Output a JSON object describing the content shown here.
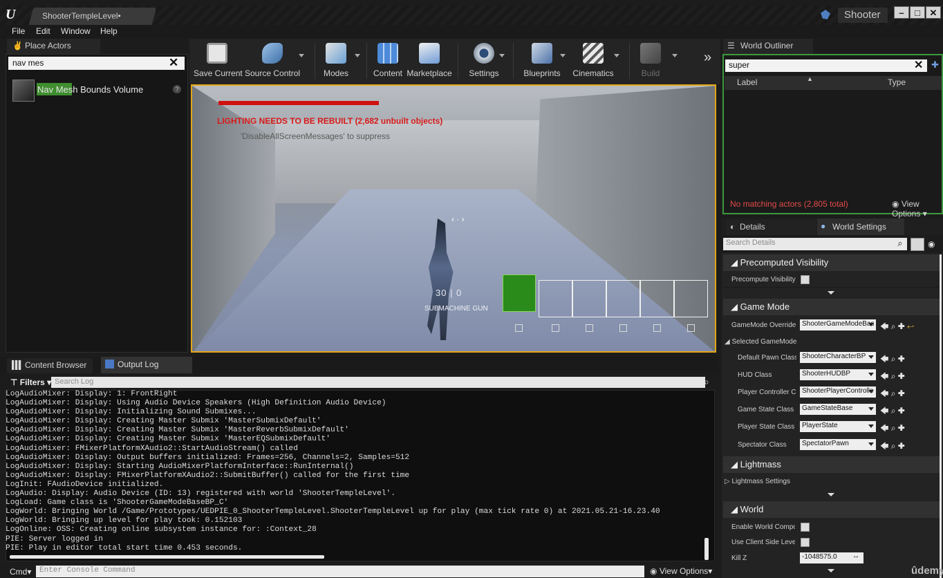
{
  "window": {
    "doc_tab": "ShooterTempleLevel•",
    "project": "Shooter",
    "min_btn": "–",
    "max_btn": "□",
    "close_btn": "✕"
  },
  "menu": {
    "file": "File",
    "edit": "Edit",
    "window": "Window",
    "help": "Help"
  },
  "place_actors": {
    "tab": "Place Actors",
    "search_value": "nav mes",
    "result_label_hl": "Nav Mes",
    "result_label_rest": "h Bounds Volume"
  },
  "toolbar": {
    "save": "Save Current",
    "source": "Source Control",
    "modes": "Modes",
    "content": "Content",
    "marketplace": "Marketplace",
    "settings": "Settings",
    "blueprints": "Blueprints",
    "cinematics": "Cinematics",
    "build": "Build",
    "more": "»"
  },
  "viewport": {
    "lighting_warning": "LIGHTING NEEDS TO BE REBUILT (2,682 unbuilt objects)",
    "sub_warning": "'DisableAllScreenMessages' to suppress",
    "ammo": "30 | 0",
    "weapon": "SUBMACHINE GUN",
    "health_fraction": 1.0
  },
  "world_outliner": {
    "tab": "World Outliner",
    "search_value": "super",
    "col_label": "Label",
    "col_type": "Type",
    "status": "No matching actors (2,805 total)",
    "view_options": "View Options"
  },
  "details": {
    "tab_details": "Details",
    "tab_world": "World Settings",
    "search_placeholder": "Search Details",
    "precomputed": {
      "category": "Precomputed Visibility",
      "precompute_label": "Precompute Visibility"
    },
    "game_mode": {
      "category": "Game Mode",
      "override_label": "GameMode Override",
      "override_value": "ShooterGameModeBas",
      "selected_label": "Selected GameMode",
      "pawn_label": "Default Pawn Class",
      "pawn_value": "ShooterCharacterBP",
      "hud_label": "HUD Class",
      "hud_value": "ShooterHUDBP",
      "pc_label": "Player Controller Cla",
      "pc_value": "ShooterPlayerControlle",
      "gs_label": "Game State Class",
      "gs_value": "GameStateBase",
      "ps_label": "Player State Class",
      "ps_value": "PlayerState",
      "spec_label": "Spectator Class",
      "spec_value": "SpectatorPawn"
    },
    "lightmass": {
      "category": "Lightmass",
      "settings_label": "Lightmass Settings"
    },
    "world": {
      "category": "World",
      "composition_label": "Enable World Compositi",
      "client_label": "Use Client Side Level St",
      "killz_label": "Kill Z",
      "killz_value": "-1048575.0"
    }
  },
  "bottom": {
    "content_browser_tab": "Content Browser",
    "output_log_tab": "Output Log",
    "filters": "Filters",
    "search_placeholder": "Search Log",
    "log_lines": [
      "LogAudioMixer: Display: 1: FrontRight",
      "LogAudioMixer: Display: Using Audio Device Speakers (High Definition Audio Device)",
      "LogAudioMixer: Display: Initializing Sound Submixes...",
      "LogAudioMixer: Display: Creating Master Submix 'MasterSubmixDefault'",
      "LogAudioMixer: Display: Creating Master Submix 'MasterReverbSubmixDefault'",
      "LogAudioMixer: Display: Creating Master Submix 'MasterEQSubmixDefault'",
      "LogAudioMixer: FMixerPlatformXAudio2::StartAudioStream() called",
      "LogAudioMixer: Display: Output buffers initialized: Frames=256, Channels=2, Samples=512",
      "LogAudioMixer: Display: Starting AudioMixerPlatformInterface::RunInternal()",
      "LogAudioMixer: Display: FMixerPlatformXAudio2::SubmitBuffer() called for the first time",
      "LogInit: FAudioDevice initialized.",
      "LogAudio: Display: Audio Device (ID: 13) registered with world 'ShooterTempleLevel'.",
      "LogLoad: Game class is 'ShooterGameModeBaseBP_C'",
      "LogWorld: Bringing World /Game/Prototypes/UEDPIE_0_ShooterTempleLevel.ShooterTempleLevel up for play (max tick rate 0) at 2021.05.21-16.23.40",
      "LogWorld: Bringing up level for play took: 0.152103",
      "LogOnline: OSS: Creating online subsystem instance for: :Context_28",
      "PIE: Server logged in",
      "PIE: Play in editor total start time 0.453 seconds."
    ],
    "cmd_label": "Cmd",
    "cmd_placeholder": "Enter Console Command",
    "view_options": "View Options"
  },
  "watermark": "ûdemy",
  "colors": {
    "accent_selection": "#e4a617",
    "outliner_border": "#3c9a3c",
    "warning_red": "#d81919"
  }
}
